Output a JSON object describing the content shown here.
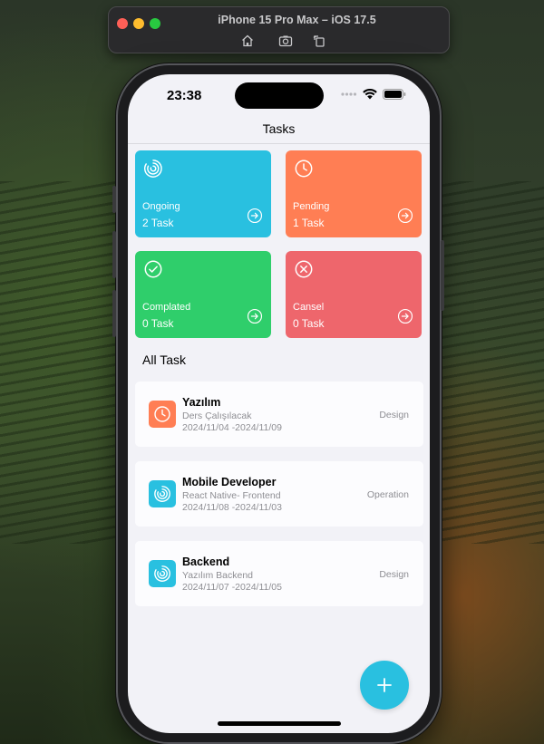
{
  "simulator": {
    "title": "iPhone 15 Pro Max – iOS 17.5",
    "buttons": [
      "home-icon",
      "screenshot-icon",
      "rotate-icon"
    ]
  },
  "status_bar": {
    "time": "23:38"
  },
  "nav": {
    "title": "Tasks"
  },
  "summary_cards": [
    {
      "label": "Ongoing",
      "count": "2 Task",
      "color": "#29c0e0",
      "icon": "progress-icon"
    },
    {
      "label": "Pending",
      "count": "1 Task",
      "color": "#ff7e54",
      "icon": "clock-icon"
    },
    {
      "label": "Complated",
      "count": "0 Task",
      "color": "#2fce6b",
      "icon": "check-circle-icon"
    },
    {
      "label": "Cansel",
      "count": "0 Task",
      "color": "#ee666c",
      "icon": "x-circle-icon"
    }
  ],
  "section": {
    "title": "All Task"
  },
  "tasks": [
    {
      "title": "Yazılım",
      "subtitle": "Ders Çalışılacak",
      "dates": "2024/11/04 -2024/11/09",
      "tag": "Design",
      "icon": "clock-icon",
      "color": "#ff7e54"
    },
    {
      "title": "Mobile Developer",
      "subtitle": "React Native- Frontend",
      "dates": "2024/11/08 -2024/11/03",
      "tag": "Operation",
      "icon": "progress-icon",
      "color": "#29c0e0"
    },
    {
      "title": "Backend",
      "subtitle": "Yazılım Backend",
      "dates": "2024/11/07 -2024/11/05",
      "tag": "Design",
      "icon": "progress-icon",
      "color": "#29c0e0"
    }
  ],
  "fab": {
    "icon": "plus-icon",
    "color": "#29c0e0"
  }
}
